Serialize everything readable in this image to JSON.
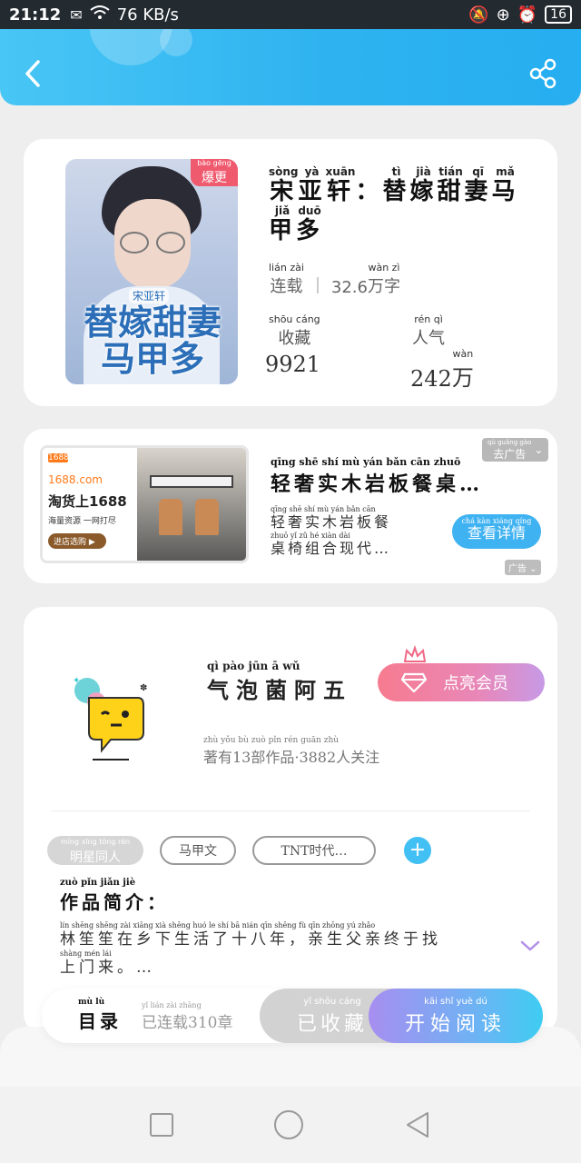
{
  "status_bar": {
    "time": "21:12",
    "speed": "76 KB/s",
    "battery": "16"
  },
  "book": {
    "cover_title": "替嫁甜妻马甲多",
    "cover_author": "宋亚轩",
    "badge": {
      "py": "bào gēng",
      "text": "爆更"
    },
    "title_chars": [
      {
        "py": "sòng",
        "ch": "宋"
      },
      {
        "py": "yà",
        "ch": "亚"
      },
      {
        "py": "xuān",
        "ch": "轩"
      },
      {
        "py": "",
        "ch": "："
      },
      {
        "py": "tì",
        "ch": "替"
      },
      {
        "py": "jià",
        "ch": "嫁"
      },
      {
        "py": "tián",
        "ch": "甜"
      },
      {
        "py": "qī",
        "ch": "妻"
      },
      {
        "py": "mǎ",
        "ch": "马"
      },
      {
        "py": "jiǎ",
        "ch": "甲"
      },
      {
        "py": "duō",
        "ch": "多"
      }
    ],
    "status": {
      "py": "lián zài",
      "text": "连载"
    },
    "word_count": {
      "num": "32.6",
      "py": "wàn zì",
      "unit": "万字"
    },
    "favorites_label": {
      "py": "shōu cáng",
      "text": "收藏"
    },
    "popularity_label": {
      "py": "rén qì",
      "text": "人气"
    },
    "favorites_value": "9921",
    "popularity_value": {
      "num": "242",
      "py": "wàn",
      "unit": "万"
    }
  },
  "ad": {
    "logo": "1688",
    "site": "1688.com",
    "slogan": "淘货上1688",
    "sub": "海量资源 一网打尽",
    "cta_small": "进店选购 ▶",
    "title": "轻奢实木岩板餐桌…",
    "title_py": "qīng shē shí mù yán bǎn cān zhuō",
    "desc_line1": "轻奢实木岩板餐",
    "desc_line1_py": "qīng shē shí mù yán bǎn cān",
    "desc_line2": "桌椅组合现代…",
    "desc_line2_py": "zhuō yǐ zǔ hé xiàn dài",
    "close_label": "去广告",
    "close_py": "qù guǎng gào",
    "button_label": "查看详情",
    "button_py": "chá kàn xiáng qíng",
    "ad_tag": "广告"
  },
  "author": {
    "name": "气泡菌阿五",
    "name_py": "qì pào jūn ā wǔ",
    "vip_button": "点亮会员",
    "stats": "著有13部作品·3882人关注",
    "stats_py": "zhù yǒu bù zuò pǐn rén guān zhù",
    "tags": [
      {
        "py": "míng xīng tóng rén",
        "text": "明星同人"
      },
      {
        "py": "",
        "text": "马甲文"
      },
      {
        "py": "",
        "text": "TNT时代…"
      }
    ],
    "intro_label": "作品简介：",
    "intro_label_py": "zuò pǐn jiǎn jiè",
    "intro_line1": "林笙笙在乡下生活了十八年，亲生父亲终于找",
    "intro_line1_py": "lín shēng shēng zài xiāng xià shēng huó le shí bā nián qīn shēng fù qīn zhōng yú zhǎo",
    "intro_line2": "上门来。…",
    "intro_line2_py": "shàng mén lái"
  },
  "bottom_bar": {
    "toc": "目录",
    "toc_py": "mù lù",
    "chapters": "已连载310章",
    "chapters_py": "yǐ lián zài zhāng",
    "fav": "已收藏",
    "fav_py": "yǐ shōu cáng",
    "read": "开始阅读",
    "read_py": "kāi shǐ yuè dú"
  },
  "colors": {
    "header": "#2fb3f0",
    "badge": "#f05a6e",
    "vip_start": "#f77b8f",
    "vip_end": "#c79ae6",
    "read_start": "#a78ef0",
    "read_end": "#3ecdf2",
    "ad_button": "#3fb2f2"
  }
}
